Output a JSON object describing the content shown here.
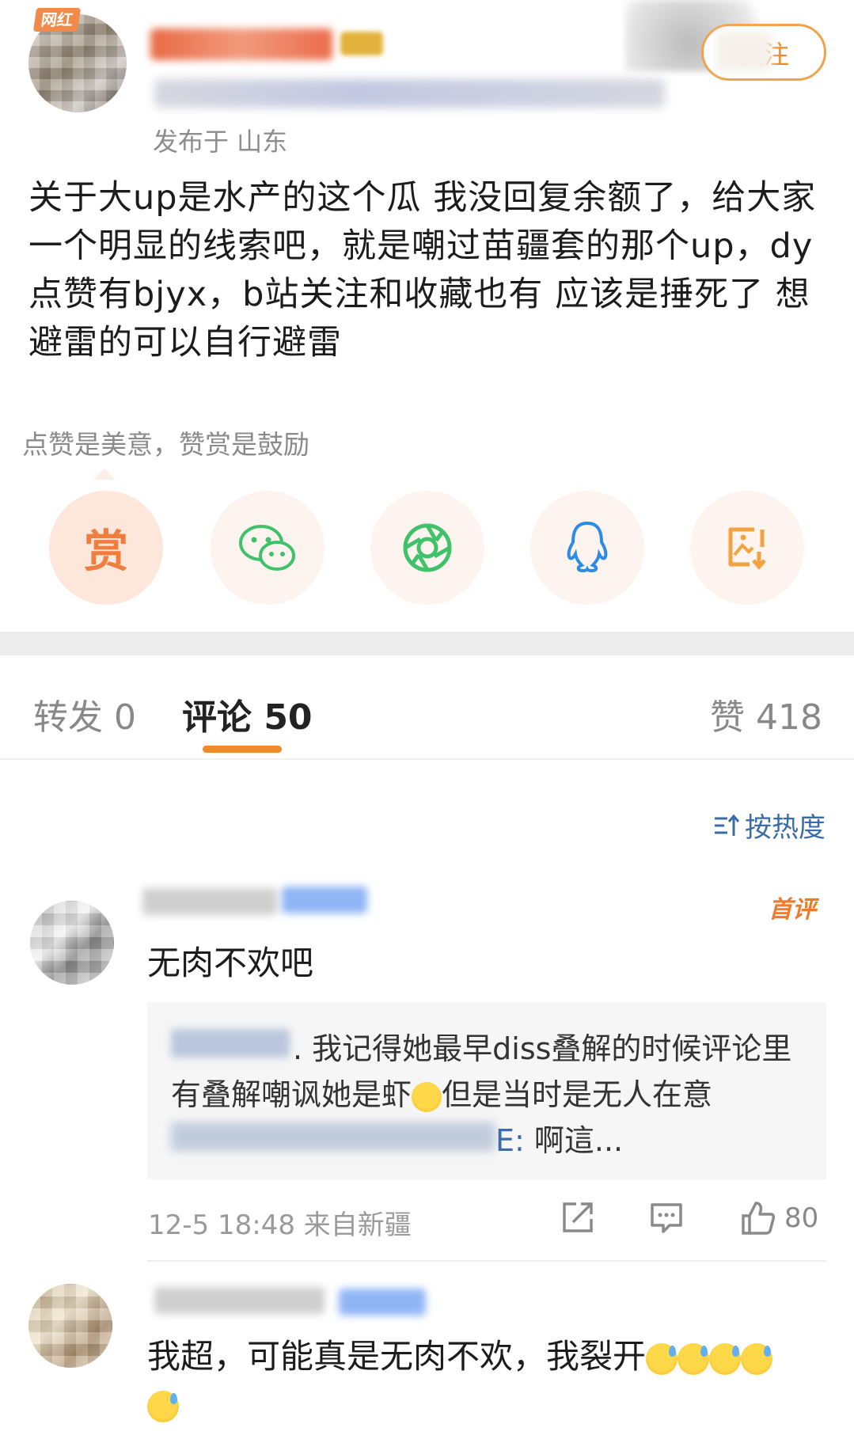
{
  "post": {
    "author_badge": "网红",
    "published_label": "发布于 山东",
    "follow_label": "关注",
    "content": "关于大up是水产的这个瓜 我没回复余额了，给大家一个明显的线索吧，就是嘲过苗疆套的那个up，dy点赞有bjyx，b站关注和收藏也有 应该是捶死了 想避雷的可以自行避雷"
  },
  "reward": {
    "caption": "点赞是美意，赞赏是鼓励",
    "reward_glyph": "赏",
    "share_icons": [
      "reward-icon",
      "wechat-icon",
      "moments-icon",
      "qq-icon",
      "save-image-icon"
    ]
  },
  "tabs": {
    "repost": "转发 0",
    "comment": "评论 50",
    "like": "赞 418"
  },
  "sort": {
    "label": "按热度"
  },
  "comments": [
    {
      "badge": "首评",
      "text": "无肉不欢吧",
      "reply_line1": ". 我记得她最早diss叠解的时候评论里",
      "reply_line2": "有叠解嘲讽她是虾",
      "reply_line2_tail": "但是当时是无人在意",
      "reply_line3_user": "E:",
      "reply_line3_text": " 啊這...",
      "time": "12-5 18:48",
      "location": "来自新疆",
      "likes": "80"
    },
    {
      "text": "我超，可能真是无肉不欢，我裂开"
    }
  ],
  "colors": {
    "accent_orange": "#f08a27",
    "link_blue": "#3a6da8",
    "wechat_green": "#3fc26a",
    "qq_blue": "#2a8be8"
  }
}
